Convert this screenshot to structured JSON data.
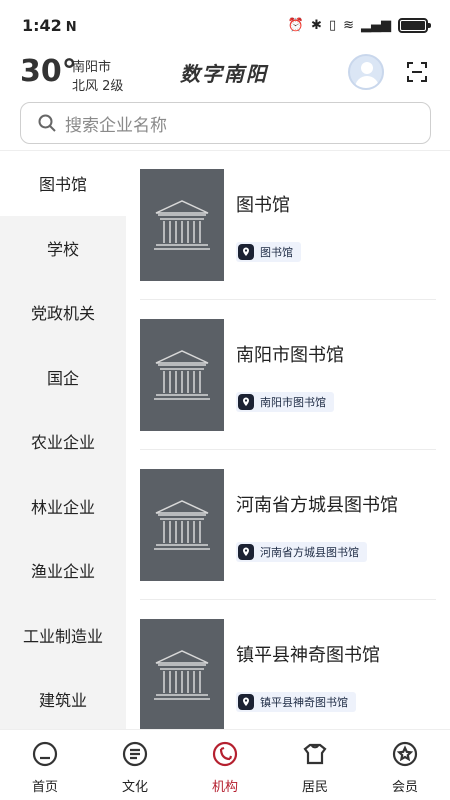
{
  "status_bar": {
    "time": "1:42",
    "nfc": "N"
  },
  "header": {
    "temperature": "30°",
    "city": "南阳市",
    "wind": "北风  2级",
    "app_title": "数字南阳"
  },
  "search": {
    "placeholder": "搜索企业名称"
  },
  "sidebar": {
    "items": [
      {
        "label": "图书馆",
        "active": true
      },
      {
        "label": "学校"
      },
      {
        "label": "党政机关"
      },
      {
        "label": "国企"
      },
      {
        "label": "农业企业"
      },
      {
        "label": "林业企业"
      },
      {
        "label": "渔业企业"
      },
      {
        "label": "工业制造业"
      },
      {
        "label": "建筑业"
      }
    ]
  },
  "list": [
    {
      "name": "图书馆",
      "tag": "图书馆"
    },
    {
      "name": "南阳市图书馆",
      "tag": "南阳市图书馆"
    },
    {
      "name": "河南省方城县图书馆",
      "tag": "河南省方城县图书馆"
    },
    {
      "name": "镇平县神奇图书馆",
      "tag": "镇平县神奇图书馆"
    }
  ],
  "tabbar": {
    "items": [
      {
        "label": "首页",
        "icon": "home-icon"
      },
      {
        "label": "文化",
        "icon": "culture-icon"
      },
      {
        "label": "机构",
        "icon": "institution-icon",
        "active": true
      },
      {
        "label": "居民",
        "icon": "resident-icon"
      },
      {
        "label": "会员",
        "icon": "member-icon"
      }
    ]
  },
  "colors": {
    "accent": "#b5202f",
    "sidebar_bg": "#f3f3f3",
    "thumb_bg": "#5b6066",
    "tag_bg": "#eef2fb"
  }
}
